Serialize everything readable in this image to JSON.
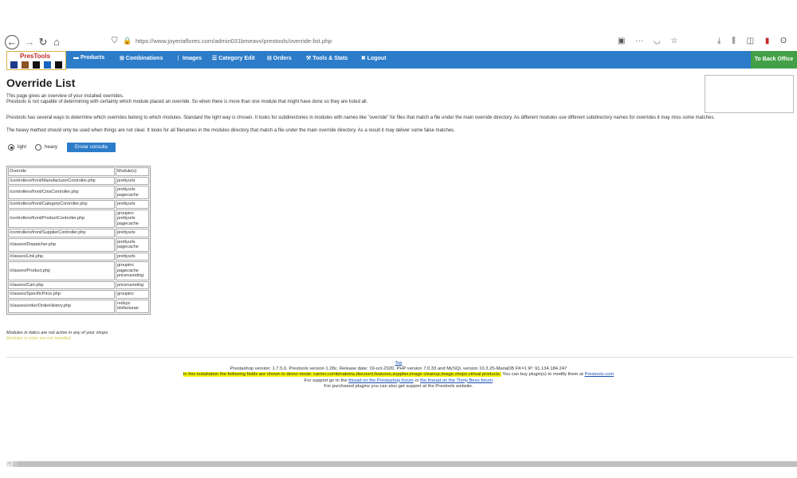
{
  "browser": {
    "url": "https://www.joyeriaflores.com/admin031bmeavv/prestools/override-list.php"
  },
  "nav": {
    "logo": "PresTools",
    "items": [
      "▬ Products",
      "⊞ Combinations",
      "⋮ Images",
      "☰ Category Edit",
      "⊟ Orders",
      "⚒ Tools & Stats",
      "✖ Logout"
    ],
    "back_office": "To Back Office"
  },
  "page": {
    "title": "Override List",
    "intro1": "This page gives an overview of your installed overrides.",
    "intro2": "Prestools is not capable of determining with certainty which module placed an override. So when there is more than one module that might have done so they are listed all.",
    "methods1": "Prestools has several ways to determine which overrides belong to which modules. Standard the light way is chosen. It looks for subdirectories in modules with names like \"override\" for files that match a file under the main override directory. As different modules use different subdirectory names for overrides it may miss some matches.",
    "methods2": "The heavy method should only be used when things are not clear. It looks for all filenames in the modules directory that match a file under the main override directory. As a result it may deliver some false matches."
  },
  "form": {
    "light_label": "light",
    "heavy_label": "heavy",
    "submit_label": "Enviar consulta"
  },
  "table": {
    "headers": [
      "Override",
      "Module(s)"
    ],
    "rows": [
      {
        "override": "/controllers/front/ManufacturerController.php",
        "modules": [
          "prettyurls"
        ]
      },
      {
        "override": "/controllers/front/CmsController.php",
        "modules": [
          "prettyurls",
          "pagecache"
        ]
      },
      {
        "override": "/controllers/front/CategoryController.php",
        "modules": [
          "prettyurls"
        ]
      },
      {
        "override": "/controllers/front/ProductController.php",
        "modules": [
          "groupinc",
          "prettyurls",
          "pagecache"
        ]
      },
      {
        "override": "/controllers/front/SupplierController.php",
        "modules": [
          "prettyurls"
        ]
      },
      {
        "override": "/classes/Dispatcher.php",
        "modules": [
          "prettyurls",
          "pagecache"
        ]
      },
      {
        "override": "/classes/Link.php",
        "modules": [
          "prettyurls"
        ]
      },
      {
        "override": "/classes/Product.php",
        "modules": [
          "groupinc",
          "pagecache",
          "pricerounding"
        ]
      },
      {
        "override": "/classes/Cart.php",
        "modules": [
          "pricerounding"
        ]
      },
      {
        "override": "/classes/SpecificPrice.php",
        "modules": [
          "groupinc"
        ]
      },
      {
        "override": "/classes/order/OrderHistory.php",
        "modules": [
          "redsys",
          "idxfacturae"
        ]
      }
    ]
  },
  "notes": {
    "italic_note": "Modules in italics are not active in any of your shops.",
    "color_note": "Modules in color are not installed"
  },
  "footer": {
    "top_link": "Top",
    "version_line": "Prestashop version: 1.7.5.0. Prestools version 1.28c. Release date: 19-oct-2020. PHP version 7.0.33 and MySQL version 10.3.25-MariaDB FK=1 IP: 91.134.184.247",
    "demo_highlight": "In this installation the following fields are shown in demo mode: carrier,combinations,discount,features,supplier,image cleanup,image,shopz,virtual products.",
    "buy_text": " You can buy plugin(s) to modify them at ",
    "buy_link": "Prestools.com",
    "support_prefix": "For support go to the ",
    "support_link1": "thread on the Prestashop forum",
    "support_or": " or ",
    "support_link2": "the thread on the Thirty Bees forum",
    "purchased": "For purchased plugins you can also get support at the Prestools website."
  }
}
